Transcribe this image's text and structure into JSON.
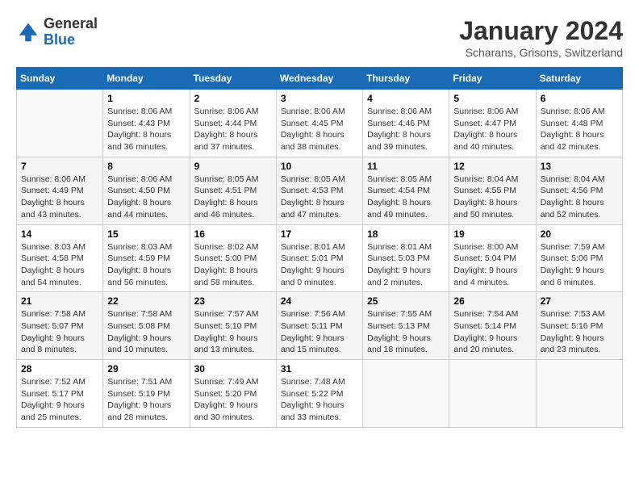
{
  "header": {
    "logo": {
      "general": "General",
      "blue": "Blue"
    },
    "title": "January 2024",
    "subtitle": "Scharans, Grisons, Switzerland"
  },
  "calendar": {
    "days_of_week": [
      "Sunday",
      "Monday",
      "Tuesday",
      "Wednesday",
      "Thursday",
      "Friday",
      "Saturday"
    ],
    "weeks": [
      {
        "row_index": 1,
        "cells": [
          {
            "day": "",
            "info": ""
          },
          {
            "day": "1",
            "info": "Sunrise: 8:06 AM\nSunset: 4:43 PM\nDaylight: 8 hours\nand 36 minutes."
          },
          {
            "day": "2",
            "info": "Sunrise: 8:06 AM\nSunset: 4:44 PM\nDaylight: 8 hours\nand 37 minutes."
          },
          {
            "day": "3",
            "info": "Sunrise: 8:06 AM\nSunset: 4:45 PM\nDaylight: 8 hours\nand 38 minutes."
          },
          {
            "day": "4",
            "info": "Sunrise: 8:06 AM\nSunset: 4:46 PM\nDaylight: 8 hours\nand 39 minutes."
          },
          {
            "day": "5",
            "info": "Sunrise: 8:06 AM\nSunset: 4:47 PM\nDaylight: 8 hours\nand 40 minutes."
          },
          {
            "day": "6",
            "info": "Sunrise: 8:06 AM\nSunset: 4:48 PM\nDaylight: 8 hours\nand 42 minutes."
          }
        ]
      },
      {
        "row_index": 2,
        "cells": [
          {
            "day": "7",
            "info": "Sunrise: 8:06 AM\nSunset: 4:49 PM\nDaylight: 8 hours\nand 43 minutes."
          },
          {
            "day": "8",
            "info": "Sunrise: 8:06 AM\nSunset: 4:50 PM\nDaylight: 8 hours\nand 44 minutes."
          },
          {
            "day": "9",
            "info": "Sunrise: 8:05 AM\nSunset: 4:51 PM\nDaylight: 8 hours\nand 46 minutes."
          },
          {
            "day": "10",
            "info": "Sunrise: 8:05 AM\nSunset: 4:53 PM\nDaylight: 8 hours\nand 47 minutes."
          },
          {
            "day": "11",
            "info": "Sunrise: 8:05 AM\nSunset: 4:54 PM\nDaylight: 8 hours\nand 49 minutes."
          },
          {
            "day": "12",
            "info": "Sunrise: 8:04 AM\nSunset: 4:55 PM\nDaylight: 8 hours\nand 50 minutes."
          },
          {
            "day": "13",
            "info": "Sunrise: 8:04 AM\nSunset: 4:56 PM\nDaylight: 8 hours\nand 52 minutes."
          }
        ]
      },
      {
        "row_index": 3,
        "cells": [
          {
            "day": "14",
            "info": "Sunrise: 8:03 AM\nSunset: 4:58 PM\nDaylight: 8 hours\nand 54 minutes."
          },
          {
            "day": "15",
            "info": "Sunrise: 8:03 AM\nSunset: 4:59 PM\nDaylight: 8 hours\nand 56 minutes."
          },
          {
            "day": "16",
            "info": "Sunrise: 8:02 AM\nSunset: 5:00 PM\nDaylight: 8 hours\nand 58 minutes."
          },
          {
            "day": "17",
            "info": "Sunrise: 8:01 AM\nSunset: 5:01 PM\nDaylight: 9 hours\nand 0 minutes."
          },
          {
            "day": "18",
            "info": "Sunrise: 8:01 AM\nSunset: 5:03 PM\nDaylight: 9 hours\nand 2 minutes."
          },
          {
            "day": "19",
            "info": "Sunrise: 8:00 AM\nSunset: 5:04 PM\nDaylight: 9 hours\nand 4 minutes."
          },
          {
            "day": "20",
            "info": "Sunrise: 7:59 AM\nSunset: 5:06 PM\nDaylight: 9 hours\nand 6 minutes."
          }
        ]
      },
      {
        "row_index": 4,
        "cells": [
          {
            "day": "21",
            "info": "Sunrise: 7:58 AM\nSunset: 5:07 PM\nDaylight: 9 hours\nand 8 minutes."
          },
          {
            "day": "22",
            "info": "Sunrise: 7:58 AM\nSunset: 5:08 PM\nDaylight: 9 hours\nand 10 minutes."
          },
          {
            "day": "23",
            "info": "Sunrise: 7:57 AM\nSunset: 5:10 PM\nDaylight: 9 hours\nand 13 minutes."
          },
          {
            "day": "24",
            "info": "Sunrise: 7:56 AM\nSunset: 5:11 PM\nDaylight: 9 hours\nand 15 minutes."
          },
          {
            "day": "25",
            "info": "Sunrise: 7:55 AM\nSunset: 5:13 PM\nDaylight: 9 hours\nand 18 minutes."
          },
          {
            "day": "26",
            "info": "Sunrise: 7:54 AM\nSunset: 5:14 PM\nDaylight: 9 hours\nand 20 minutes."
          },
          {
            "day": "27",
            "info": "Sunrise: 7:53 AM\nSunset: 5:16 PM\nDaylight: 9 hours\nand 23 minutes."
          }
        ]
      },
      {
        "row_index": 5,
        "cells": [
          {
            "day": "28",
            "info": "Sunrise: 7:52 AM\nSunset: 5:17 PM\nDaylight: 9 hours\nand 25 minutes."
          },
          {
            "day": "29",
            "info": "Sunrise: 7:51 AM\nSunset: 5:19 PM\nDaylight: 9 hours\nand 28 minutes."
          },
          {
            "day": "30",
            "info": "Sunrise: 7:49 AM\nSunset: 5:20 PM\nDaylight: 9 hours\nand 30 minutes."
          },
          {
            "day": "31",
            "info": "Sunrise: 7:48 AM\nSunset: 5:22 PM\nDaylight: 9 hours\nand 33 minutes."
          },
          {
            "day": "",
            "info": ""
          },
          {
            "day": "",
            "info": ""
          },
          {
            "day": "",
            "info": ""
          }
        ]
      }
    ]
  }
}
